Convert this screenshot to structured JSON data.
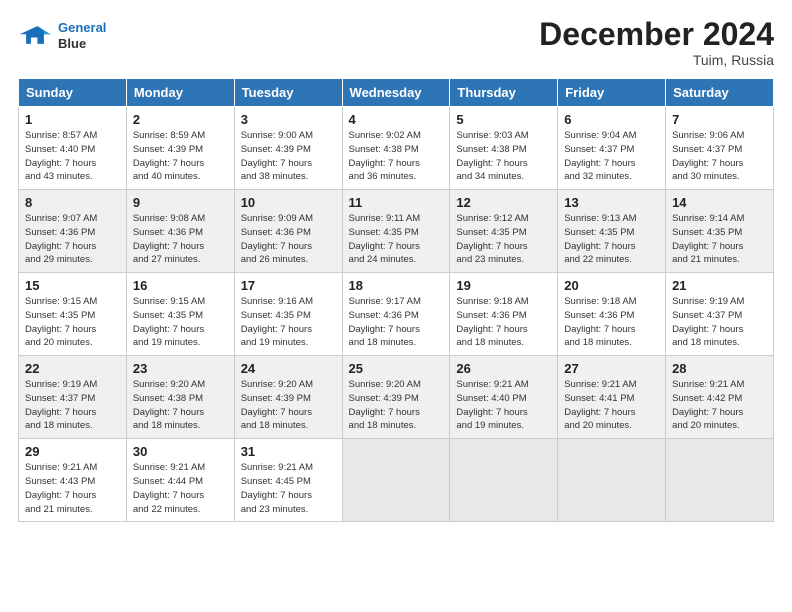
{
  "header": {
    "logo_line1": "General",
    "logo_line2": "Blue",
    "month": "December 2024",
    "location": "Tuim, Russia"
  },
  "days_of_week": [
    "Sunday",
    "Monday",
    "Tuesday",
    "Wednesday",
    "Thursday",
    "Friday",
    "Saturday"
  ],
  "weeks": [
    [
      {
        "day": "1",
        "info": "Sunrise: 8:57 AM\nSunset: 4:40 PM\nDaylight: 7 hours\nand 43 minutes."
      },
      {
        "day": "2",
        "info": "Sunrise: 8:59 AM\nSunset: 4:39 PM\nDaylight: 7 hours\nand 40 minutes."
      },
      {
        "day": "3",
        "info": "Sunrise: 9:00 AM\nSunset: 4:39 PM\nDaylight: 7 hours\nand 38 minutes."
      },
      {
        "day": "4",
        "info": "Sunrise: 9:02 AM\nSunset: 4:38 PM\nDaylight: 7 hours\nand 36 minutes."
      },
      {
        "day": "5",
        "info": "Sunrise: 9:03 AM\nSunset: 4:38 PM\nDaylight: 7 hours\nand 34 minutes."
      },
      {
        "day": "6",
        "info": "Sunrise: 9:04 AM\nSunset: 4:37 PM\nDaylight: 7 hours\nand 32 minutes."
      },
      {
        "day": "7",
        "info": "Sunrise: 9:06 AM\nSunset: 4:37 PM\nDaylight: 7 hours\nand 30 minutes."
      }
    ],
    [
      {
        "day": "8",
        "info": "Sunrise: 9:07 AM\nSunset: 4:36 PM\nDaylight: 7 hours\nand 29 minutes."
      },
      {
        "day": "9",
        "info": "Sunrise: 9:08 AM\nSunset: 4:36 PM\nDaylight: 7 hours\nand 27 minutes."
      },
      {
        "day": "10",
        "info": "Sunrise: 9:09 AM\nSunset: 4:36 PM\nDaylight: 7 hours\nand 26 minutes."
      },
      {
        "day": "11",
        "info": "Sunrise: 9:11 AM\nSunset: 4:35 PM\nDaylight: 7 hours\nand 24 minutes."
      },
      {
        "day": "12",
        "info": "Sunrise: 9:12 AM\nSunset: 4:35 PM\nDaylight: 7 hours\nand 23 minutes."
      },
      {
        "day": "13",
        "info": "Sunrise: 9:13 AM\nSunset: 4:35 PM\nDaylight: 7 hours\nand 22 minutes."
      },
      {
        "day": "14",
        "info": "Sunrise: 9:14 AM\nSunset: 4:35 PM\nDaylight: 7 hours\nand 21 minutes."
      }
    ],
    [
      {
        "day": "15",
        "info": "Sunrise: 9:15 AM\nSunset: 4:35 PM\nDaylight: 7 hours\nand 20 minutes."
      },
      {
        "day": "16",
        "info": "Sunrise: 9:15 AM\nSunset: 4:35 PM\nDaylight: 7 hours\nand 19 minutes."
      },
      {
        "day": "17",
        "info": "Sunrise: 9:16 AM\nSunset: 4:35 PM\nDaylight: 7 hours\nand 19 minutes."
      },
      {
        "day": "18",
        "info": "Sunrise: 9:17 AM\nSunset: 4:36 PM\nDaylight: 7 hours\nand 18 minutes."
      },
      {
        "day": "19",
        "info": "Sunrise: 9:18 AM\nSunset: 4:36 PM\nDaylight: 7 hours\nand 18 minutes."
      },
      {
        "day": "20",
        "info": "Sunrise: 9:18 AM\nSunset: 4:36 PM\nDaylight: 7 hours\nand 18 minutes."
      },
      {
        "day": "21",
        "info": "Sunrise: 9:19 AM\nSunset: 4:37 PM\nDaylight: 7 hours\nand 18 minutes."
      }
    ],
    [
      {
        "day": "22",
        "info": "Sunrise: 9:19 AM\nSunset: 4:37 PM\nDaylight: 7 hours\nand 18 minutes."
      },
      {
        "day": "23",
        "info": "Sunrise: 9:20 AM\nSunset: 4:38 PM\nDaylight: 7 hours\nand 18 minutes."
      },
      {
        "day": "24",
        "info": "Sunrise: 9:20 AM\nSunset: 4:39 PM\nDaylight: 7 hours\nand 18 minutes."
      },
      {
        "day": "25",
        "info": "Sunrise: 9:20 AM\nSunset: 4:39 PM\nDaylight: 7 hours\nand 18 minutes."
      },
      {
        "day": "26",
        "info": "Sunrise: 9:21 AM\nSunset: 4:40 PM\nDaylight: 7 hours\nand 19 minutes."
      },
      {
        "day": "27",
        "info": "Sunrise: 9:21 AM\nSunset: 4:41 PM\nDaylight: 7 hours\nand 20 minutes."
      },
      {
        "day": "28",
        "info": "Sunrise: 9:21 AM\nSunset: 4:42 PM\nDaylight: 7 hours\nand 20 minutes."
      }
    ],
    [
      {
        "day": "29",
        "info": "Sunrise: 9:21 AM\nSunset: 4:43 PM\nDaylight: 7 hours\nand 21 minutes."
      },
      {
        "day": "30",
        "info": "Sunrise: 9:21 AM\nSunset: 4:44 PM\nDaylight: 7 hours\nand 22 minutes."
      },
      {
        "day": "31",
        "info": "Sunrise: 9:21 AM\nSunset: 4:45 PM\nDaylight: 7 hours\nand 23 minutes."
      },
      null,
      null,
      null,
      null
    ]
  ]
}
